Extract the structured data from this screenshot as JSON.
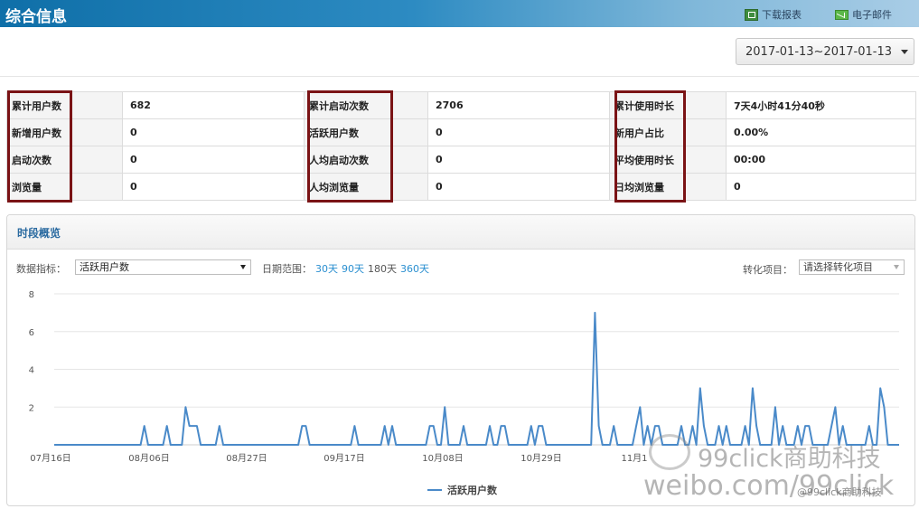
{
  "header": {
    "title": "综合信息",
    "download_label": "下载报表",
    "email_label": "电子邮件"
  },
  "date_range": "2017-01-13~2017-01-13",
  "summary": [
    [
      {
        "label": "累计用户数",
        "value": "682"
      },
      {
        "label": "累计启动次数",
        "value": "2706"
      },
      {
        "label": "累计使用时长",
        "value": "7天4小时41分40秒"
      }
    ],
    [
      {
        "label": "新增用户数",
        "value": "0"
      },
      {
        "label": "活跃用户数",
        "value": "0"
      },
      {
        "label": "新用户占比",
        "value": "0.00%"
      }
    ],
    [
      {
        "label": "启动次数",
        "value": "0"
      },
      {
        "label": "人均启动次数",
        "value": "0"
      },
      {
        "label": "平均使用时长",
        "value": "00:00"
      }
    ],
    [
      {
        "label": "浏览量",
        "value": "0"
      },
      {
        "label": "人均浏览量",
        "value": "0"
      },
      {
        "label": "日均浏览量",
        "value": "0"
      }
    ]
  ],
  "panel": {
    "title": "时段概览",
    "metric_label": "数据指标：",
    "metric_value": "活跃用户数",
    "range_label": "日期范围：",
    "ranges": [
      "30天",
      "90天",
      "180天",
      "360天"
    ],
    "conversion_label": "转化项目：",
    "conversion_placeholder": "请选择转化项目"
  },
  "colors": {
    "accent": "#0f6fa8",
    "series": "#4a8ac9",
    "highlight_box": "#7a1315"
  },
  "chart_data": {
    "type": "line",
    "title": "",
    "xlabel": "",
    "ylabel": "",
    "ylim": [
      0,
      8
    ],
    "yticks": [
      2,
      4,
      6,
      8
    ],
    "grid": true,
    "legend": "bottom",
    "x_tick_labels": [
      "07月16日",
      "08月06日",
      "08月27日",
      "09月17日",
      "10月08日",
      "10月29日",
      "11月1"
    ],
    "series": [
      {
        "name": "活跃用户数",
        "values": [
          0,
          0,
          0,
          0,
          0,
          0,
          0,
          0,
          0,
          0,
          0,
          0,
          0,
          0,
          0,
          0,
          0,
          0,
          0,
          0,
          0,
          0,
          0,
          0,
          1,
          0,
          0,
          0,
          0,
          0,
          1,
          0,
          0,
          0,
          0,
          2,
          1,
          1,
          1,
          0,
          0,
          0,
          0,
          0,
          1,
          0,
          0,
          0,
          0,
          0,
          0,
          0,
          0,
          0,
          0,
          0,
          0,
          0,
          0,
          0,
          0,
          0,
          0,
          0,
          0,
          0,
          1,
          1,
          0,
          0,
          0,
          0,
          0,
          0,
          0,
          0,
          0,
          0,
          0,
          0,
          1,
          0,
          0,
          0,
          0,
          0,
          0,
          0,
          1,
          0,
          1,
          0,
          0,
          0,
          0,
          0,
          0,
          0,
          0,
          0,
          1,
          1,
          0,
          0,
          2,
          0,
          0,
          0,
          0,
          1,
          0,
          0,
          0,
          0,
          0,
          0,
          1,
          0,
          0,
          1,
          1,
          0,
          0,
          0,
          0,
          0,
          0,
          1,
          0,
          1,
          1,
          0,
          0,
          0,
          0,
          0,
          0,
          0,
          0,
          0,
          0,
          0,
          0,
          0,
          7,
          1,
          0,
          0,
          0,
          1,
          0,
          0,
          0,
          0,
          0,
          1,
          2,
          0,
          1,
          0,
          1,
          1,
          0,
          0,
          0,
          0,
          0,
          1,
          0,
          0,
          1,
          0,
          3,
          1,
          0,
          0,
          0,
          1,
          0,
          1,
          0,
          0,
          0,
          0,
          1,
          0,
          3,
          1,
          0,
          0,
          0,
          0,
          2,
          0,
          1,
          0,
          0,
          0,
          1,
          0,
          1,
          1,
          0,
          0,
          0,
          0,
          0,
          1,
          2,
          0,
          1,
          0,
          0,
          0,
          0,
          0,
          0,
          1,
          0,
          0,
          3,
          2,
          0,
          0,
          0,
          0
        ]
      }
    ]
  }
}
